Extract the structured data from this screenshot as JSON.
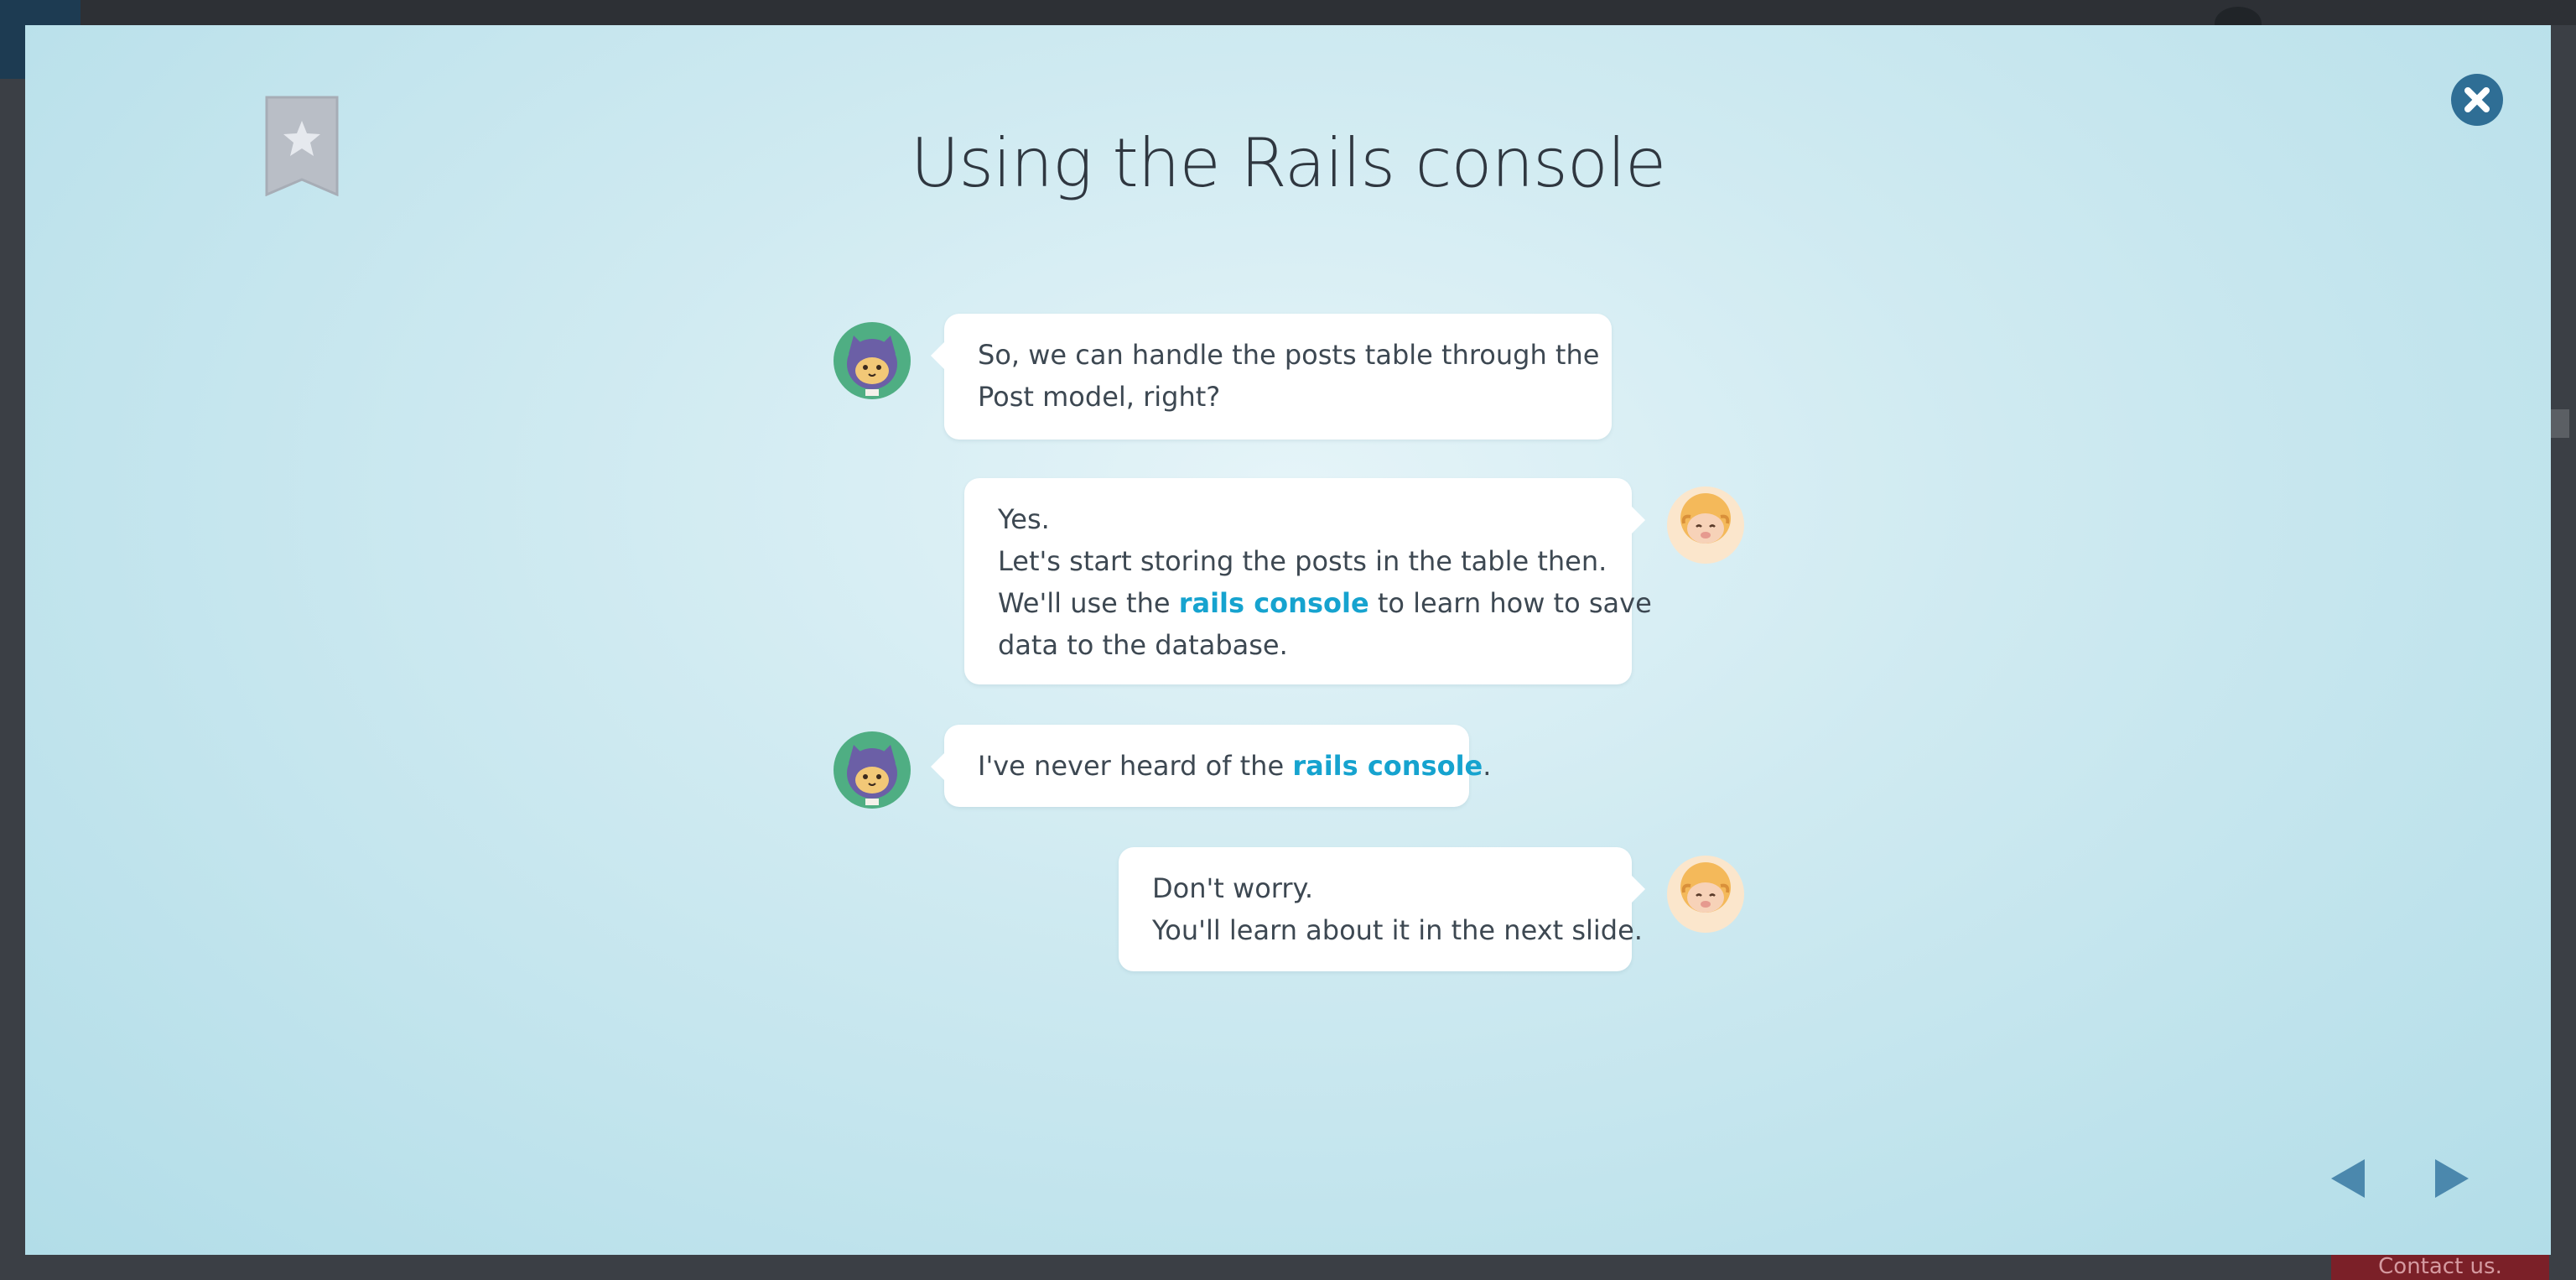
{
  "slide": {
    "title": "Using the Rails console"
  },
  "messages": [
    {
      "speaker": "cat",
      "lines": [
        {
          "parts": [
            "So, we can handle the posts table through the"
          ]
        },
        {
          "parts": [
            "Post model, right?"
          ]
        }
      ]
    },
    {
      "speaker": "sheep",
      "lines": [
        {
          "text": "Yes."
        },
        {
          "text": "Let's start storing the posts in the table then."
        },
        {
          "before": "We'll use the ",
          "keyword": "rails console",
          "after": " to learn how to save"
        },
        {
          "text": "data to the database."
        }
      ]
    },
    {
      "speaker": "cat",
      "before": "I've never heard of the ",
      "keyword": "rails console",
      "after": "."
    },
    {
      "speaker": "sheep",
      "lines": [
        {
          "text": "Don't worry."
        },
        {
          "text": "You'll learn about it in the next slide."
        }
      ]
    }
  ],
  "controls": {
    "bookmark_icon": "bookmark-star-icon",
    "close_icon": "close-icon",
    "prev_icon": "triangle-left-icon",
    "next_icon": "triangle-right-icon"
  },
  "background": {
    "contact_label": "Contact us."
  },
  "colors": {
    "keyword": "#16a3cf",
    "close_button": "#2f6e95",
    "nav_arrow": "#4b88ad",
    "bookmark": "#b9bec6"
  }
}
